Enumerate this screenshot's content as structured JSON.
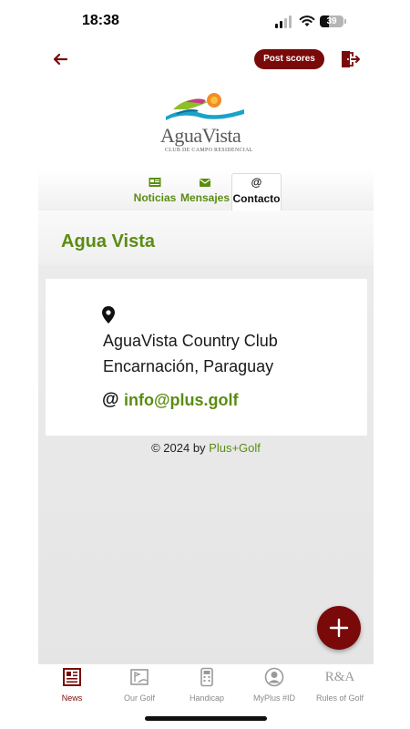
{
  "status_bar": {
    "time": "18:38",
    "battery": "39",
    "battery_level": 0.39
  },
  "header": {
    "post_scores_label": "Post scores"
  },
  "logo": {
    "name": "AguaVista",
    "subtitle": "CLUB DE CAMPO RESIDENCIAL"
  },
  "tabs": [
    {
      "label": "Noticias",
      "icon": "newspaper-icon",
      "active": false
    },
    {
      "label": "Mensajes",
      "icon": "envelope-icon",
      "active": false
    },
    {
      "label": "Contacto",
      "icon": "at-icon",
      "active": true
    }
  ],
  "club": {
    "title": "Agua Vista"
  },
  "contact": {
    "address_line1": "AguaVista Country Club",
    "address_line2": "Encarnación, Paraguay",
    "at_symbol": "@",
    "email": "info@plus.golf"
  },
  "footer": {
    "copyright_prefix": "© 2024 by ",
    "brand_link": "Plus+Golf"
  },
  "bottom_nav": [
    {
      "label": "News",
      "icon": "newspaper-icon",
      "active": true
    },
    {
      "label": "Our Golf",
      "icon": "golf-course-icon",
      "active": false
    },
    {
      "label": "Handicap",
      "icon": "calculator-icon",
      "active": false
    },
    {
      "label": "MyPlus #ID",
      "icon": "user-avatar-icon",
      "active": false
    },
    {
      "label": "Rules of Golf",
      "icon": "ra-logo-icon",
      "active": false,
      "icon_text": "R&A"
    }
  ],
  "colors": {
    "accent_green": "#5b8c12",
    "brand_maroon": "#7a0a0a"
  }
}
